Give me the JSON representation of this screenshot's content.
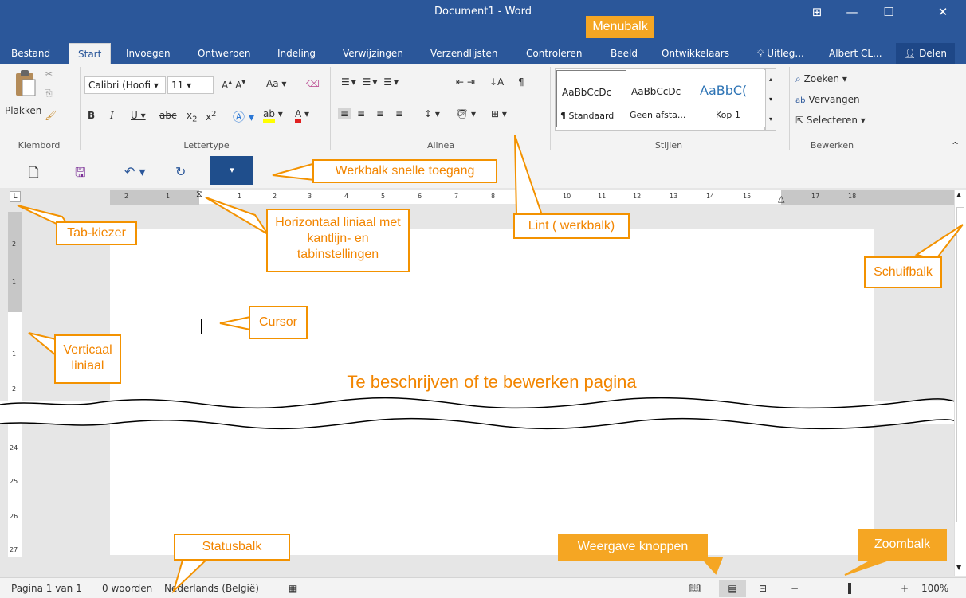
{
  "window": {
    "title": "Document1 - Word"
  },
  "tabs": [
    "Bestand",
    "Start",
    "Invoegen",
    "Ontwerpen",
    "Indeling",
    "Verwijzingen",
    "Verzendlijsten",
    "Controleren",
    "Beeld",
    "Ontwikkelaars"
  ],
  "tell_me": "Uitleg...",
  "user": "Albert CL...",
  "share": "Delen",
  "ribbon": {
    "paste": "Plakken",
    "font_name": "Calibri (Hoofi",
    "font_size": "11",
    "groups": {
      "clipboard": "Klembord",
      "font": "Lettertype",
      "paragraph": "Alinea",
      "styles": "Stijlen",
      "edit": "Bewerken"
    },
    "styles": [
      {
        "preview": "AaBbCcDc",
        "name": "¶ Standaard"
      },
      {
        "preview": "AaBbCcDc",
        "name": "Geen afsta..."
      },
      {
        "preview": "AaBbC(",
        "name": "Kop 1"
      }
    ],
    "edit_items": [
      "Zoeken",
      "Vervangen",
      "Selecteren"
    ]
  },
  "ruler": {
    "h_numbers": [
      "2",
      "1",
      "1",
      "2",
      "3",
      "4",
      "5",
      "6",
      "7",
      "8",
      "10",
      "11",
      "12",
      "13",
      "14",
      "15",
      "17",
      "18"
    ],
    "v_numbers_top": [
      "2",
      "1",
      "1",
      "2"
    ],
    "v_numbers_bottom": [
      "24",
      "25",
      "26",
      "27"
    ]
  },
  "page_caption": "Te beschrijven of te bewerken pagina",
  "status": {
    "page": "Pagina 1 van 1",
    "words": "0 woorden",
    "language": "Nederlands (België)",
    "zoom": "100%"
  },
  "callouts": {
    "menubalk": "Menubalk",
    "qat": "Werkbalk snelle toegang",
    "tab_kiezer": "Tab-kiezer",
    "hruler": "Horizontaal liniaal met kantlijn- en tabinstellingen",
    "lint": "Lint ( werkbalk)",
    "schuifbalk": "Schuifbalk",
    "cursor": "Cursor",
    "vruler": "Verticaal liniaal",
    "statusbalk": "Statusbalk",
    "weergave": "Weergave knoppen",
    "zoombalk": "Zoombalk"
  },
  "colors": {
    "word_blue": "#2b579a",
    "accent_orange": "#f39200",
    "callout_fill": "#f5a623"
  }
}
